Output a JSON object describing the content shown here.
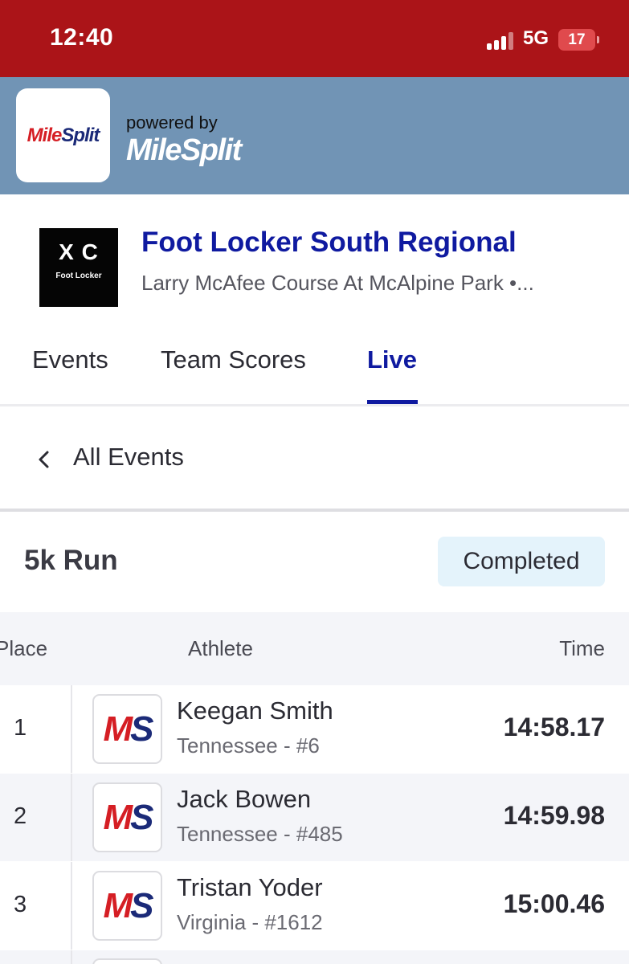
{
  "status_bar": {
    "time": "12:40",
    "network": "5G",
    "battery": "17"
  },
  "brand": {
    "logo_mile": "Mile",
    "logo_split": "Split",
    "powered_by": "powered by",
    "name": "MileSplit",
    "colors": {
      "header": "#7194b5",
      "status": "#ab1418"
    }
  },
  "meet": {
    "logo_mark": "X C",
    "logo_sub": "Foot Locker",
    "title": "Foot Locker South Regional",
    "location": "Larry McAfee Course At McAlpine Park •..."
  },
  "tabs": [
    {
      "label": "Events",
      "active": false
    },
    {
      "label": "Team Scores",
      "active": false
    },
    {
      "label": "Live",
      "active": true
    }
  ],
  "nav": {
    "back_label": "All Events"
  },
  "event": {
    "name": "5k Run",
    "status": "Completed"
  },
  "table": {
    "headers": {
      "place": "Place",
      "athlete": "Athlete",
      "time": "Time"
    },
    "rows": [
      {
        "place": "1",
        "name": "Keegan Smith",
        "team": "Tennessee - #6",
        "time": "14:58.17",
        "avatar": "MS"
      },
      {
        "place": "2",
        "name": "Jack Bowen",
        "team": "Tennessee - #485",
        "time": "14:59.98",
        "avatar": "MS"
      },
      {
        "place": "3",
        "name": "Tristan Yoder",
        "team": "Virginia - #1612",
        "time": "15:00.46",
        "avatar": "MS"
      }
    ]
  }
}
